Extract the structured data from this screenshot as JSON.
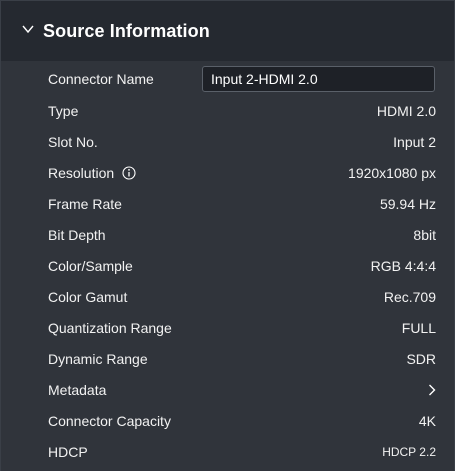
{
  "section": {
    "title": "Source Information",
    "expanded": true
  },
  "fields": {
    "connector_name": {
      "label": "Connector Name",
      "value": "Input 2-HDMI 2.0"
    },
    "type": {
      "label": "Type",
      "value": "HDMI 2.0"
    },
    "slot_no": {
      "label": "Slot No.",
      "value": "Input 2"
    },
    "resolution": {
      "label": "Resolution",
      "value": "1920x1080 px"
    },
    "frame_rate": {
      "label": "Frame Rate",
      "value": "59.94 Hz"
    },
    "bit_depth": {
      "label": "Bit Depth",
      "value": "8bit"
    },
    "color_sample": {
      "label": "Color/Sample",
      "value": "RGB 4:4:4"
    },
    "color_gamut": {
      "label": "Color Gamut",
      "value": "Rec.709"
    },
    "quantization_range": {
      "label": "Quantization Range",
      "value": "FULL"
    },
    "dynamic_range": {
      "label": "Dynamic Range",
      "value": "SDR"
    },
    "metadata": {
      "label": "Metadata"
    },
    "connector_capacity": {
      "label": "Connector Capacity",
      "value": "4K"
    },
    "hdcp": {
      "label": "HDCP",
      "value": "HDCP 2.2"
    }
  },
  "icons": {
    "collapse": "chevron-down-icon",
    "info": "info-icon",
    "expand_metadata": "chevron-right-icon"
  },
  "colors": {
    "header_bg": "#252930",
    "panel_bg": "#30343b",
    "input_bg": "#1e2127",
    "text": "#ffffff"
  }
}
